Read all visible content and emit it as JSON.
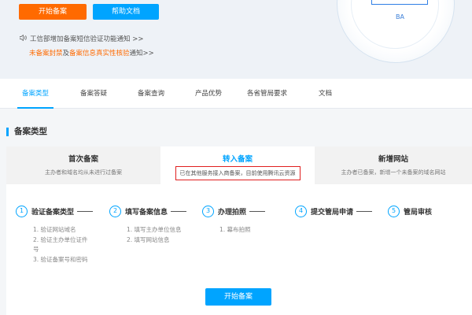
{
  "hero": {
    "start_button": "开始备案",
    "help_button": "帮助文档",
    "notice1": "工信部增加备案短信验证功能通知 >>",
    "notice2_part1": "未备案封禁",
    "notice2_mid": "及",
    "notice2_part2": "备案信息真实性核验",
    "notice2_end": "通知>>",
    "deco_label": "BA"
  },
  "tabs": [
    {
      "label": "备案类型",
      "active": true
    },
    {
      "label": "备案答疑"
    },
    {
      "label": "备案查询"
    },
    {
      "label": "产品优势"
    },
    {
      "label": "各省管局要求"
    },
    {
      "label": "文档"
    }
  ],
  "section": {
    "title": "备案类型"
  },
  "types": [
    {
      "title": "首次备案",
      "desc": "主办者和域名均从未进行过备案"
    },
    {
      "title": "转入备案",
      "desc": "已在其他服务接入商备案，目前使用腾讯云资源",
      "active": true
    },
    {
      "title": "新增网站",
      "desc": "主办者已备案，新增一个未备案的域名网站"
    }
  ],
  "steps": [
    {
      "num": "1",
      "label": "验证备案类型"
    },
    {
      "num": "2",
      "label": "填写备案信息"
    },
    {
      "num": "3",
      "label": "办理拍照"
    },
    {
      "num": "4",
      "label": "提交管局申请"
    },
    {
      "num": "5",
      "label": "管局审核"
    }
  ],
  "step_details": {
    "s1": [
      "1. 验证网站域名",
      "2. 验证主办单位证件",
      "号",
      "3. 验证备案号和密码"
    ],
    "s2": [
      "1. 填写主办单位信息",
      "2. 填写网站信息"
    ],
    "s3": [
      "1. 幕布拍照"
    ]
  },
  "bottom_button": "开始备案",
  "colors": {
    "accent": "#00a4ff",
    "orange": "#ff6a00",
    "highlight_border": "#e02020"
  }
}
